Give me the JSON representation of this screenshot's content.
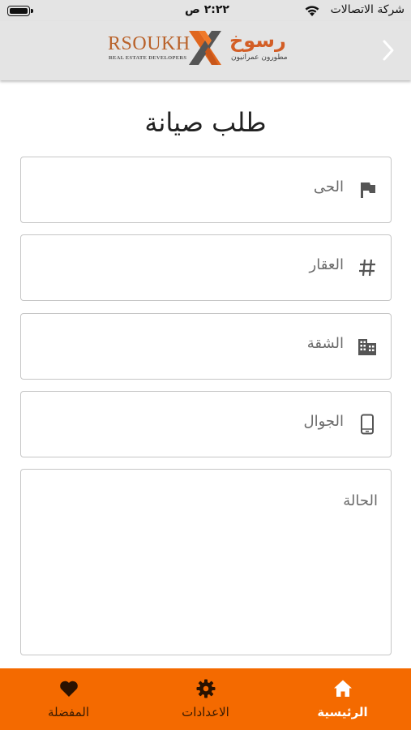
{
  "status_bar": {
    "carrier": "شركة الاتصالات",
    "time": "٢:٢٢ ص"
  },
  "header": {
    "logo_en": "RSOUKH",
    "logo_en_sub": "REAL ESTATE DEVELOPERS",
    "logo_ar": "رسوخ",
    "logo_ar_sub": "مطورون عمرانيون"
  },
  "page": {
    "title": "طلب صيانة"
  },
  "form": {
    "district_placeholder": "الحى",
    "property_placeholder": "العقار",
    "apartment_placeholder": "الشقة",
    "mobile_placeholder": "الجوال",
    "status_placeholder": "الحالة"
  },
  "icons": {
    "district": "flag-icon",
    "property": "hash-icon",
    "apartment": "building-icon",
    "mobile": "phone-icon",
    "back": "chevron-right-icon",
    "home": "home-icon",
    "settings": "gear-icon",
    "favorites": "heart-icon"
  },
  "bottom_nav": {
    "home": "الرئيسية",
    "settings": "الاعدادات",
    "favorites": "المفضلة"
  },
  "colors": {
    "accent": "#f46a00",
    "header_bg": "#e4e4e4",
    "logo_orange": "#d35e26"
  }
}
